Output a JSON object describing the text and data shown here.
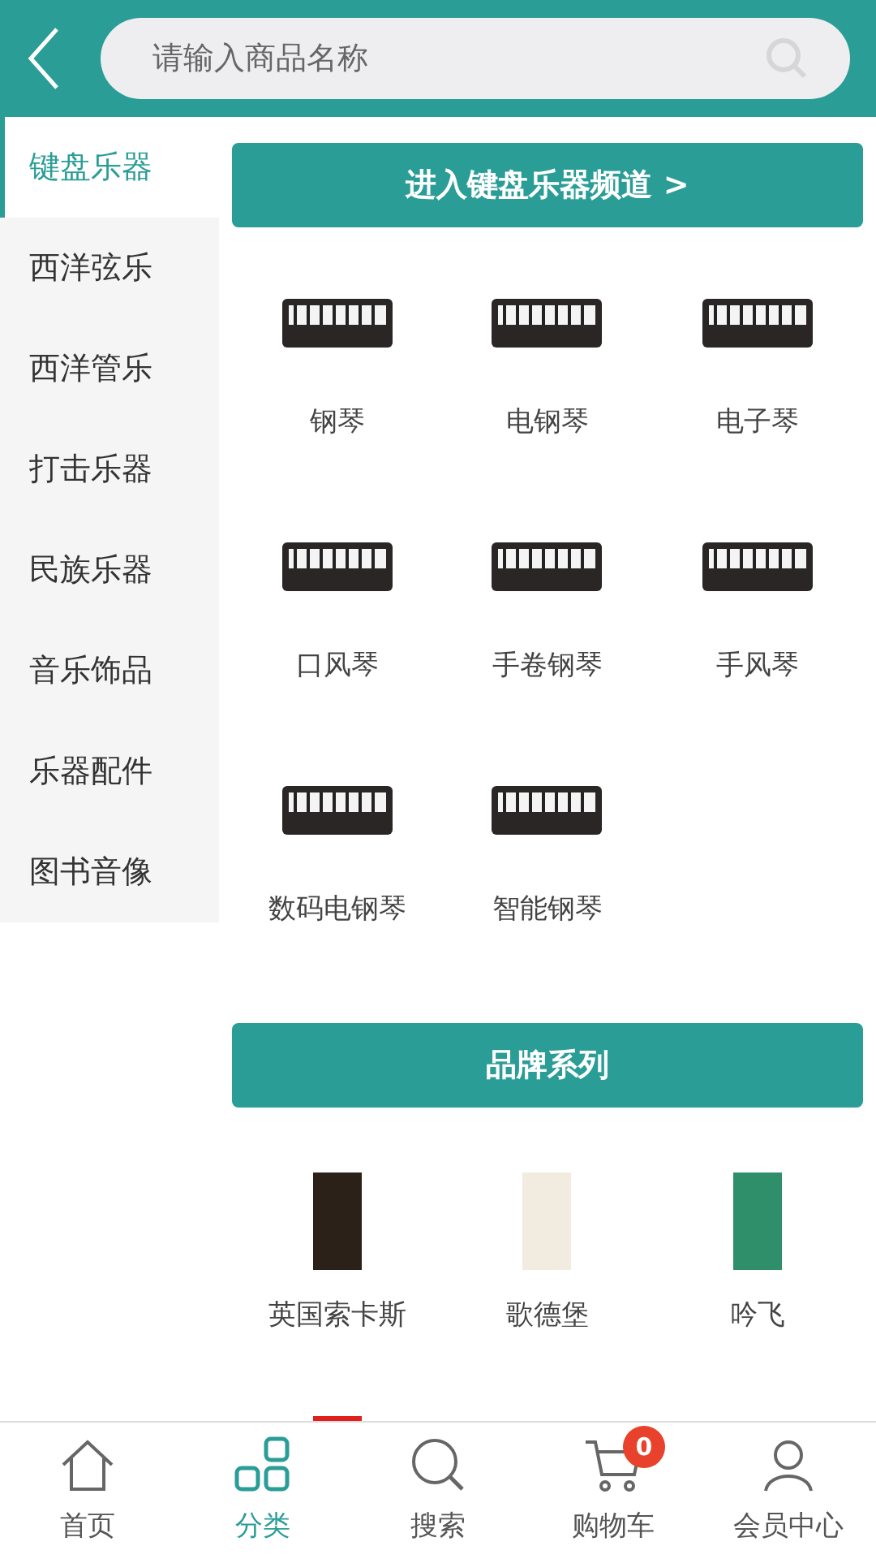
{
  "header": {
    "search": {
      "placeholder": "请输入商品名称"
    }
  },
  "sidebar": {
    "items": [
      {
        "label": "键盘乐器",
        "selected": true
      },
      {
        "label": "西洋弦乐",
        "selected": false
      },
      {
        "label": "西洋管乐",
        "selected": false
      },
      {
        "label": "打击乐器",
        "selected": false
      },
      {
        "label": "民族乐器",
        "selected": false
      },
      {
        "label": "音乐饰品",
        "selected": false
      },
      {
        "label": "乐器配件",
        "selected": false
      },
      {
        "label": "图书音像",
        "selected": false
      }
    ]
  },
  "channel_button": "进入键盘乐器频道 >",
  "products": [
    {
      "name": "钢琴"
    },
    {
      "name": "电钢琴"
    },
    {
      "name": "电子琴"
    },
    {
      "name": "口风琴"
    },
    {
      "name": "手卷钢琴"
    },
    {
      "name": "手风琴"
    },
    {
      "name": "数码电钢琴"
    },
    {
      "name": "智能钢琴"
    }
  ],
  "brand_section": {
    "title": "品牌系列",
    "brands": [
      {
        "name": "英国索卡斯",
        "color": "#2b2118"
      },
      {
        "name": "歌德堡",
        "color": "#f1ebe0"
      },
      {
        "name": "吟飞",
        "color": "#2f8f6a"
      },
      {
        "color": "#e0201c"
      }
    ]
  },
  "tab_bar": {
    "cart_badge": "0",
    "tabs": [
      {
        "label": "首页",
        "kind": "home",
        "selected": false
      },
      {
        "label": "分类",
        "kind": "grid",
        "selected": true
      },
      {
        "label": "搜索",
        "kind": "search",
        "selected": false
      },
      {
        "label": "购物车",
        "kind": "cart",
        "selected": false
      },
      {
        "label": "会员中心",
        "kind": "user",
        "selected": false
      }
    ]
  }
}
